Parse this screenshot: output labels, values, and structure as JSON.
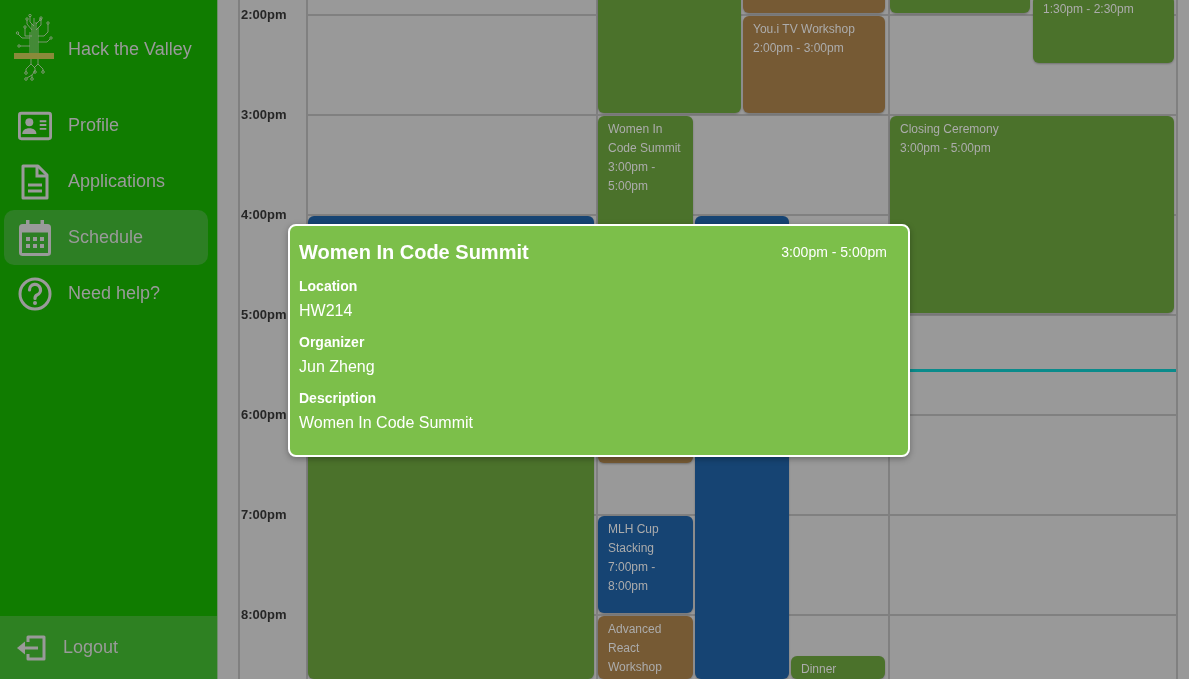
{
  "sidebar": {
    "brand": "Hack the Valley",
    "items": [
      {
        "label": "Profile",
        "selected": false
      },
      {
        "label": "Applications",
        "selected": false
      },
      {
        "label": "Schedule",
        "selected": true
      },
      {
        "label": "Need help?",
        "selected": false
      }
    ],
    "logout": "Logout"
  },
  "calendar": {
    "time_labels": [
      "2:00pm",
      "3:00pm",
      "4:00pm",
      "5:00pm",
      "6:00pm",
      "7:00pm",
      "8:00pm"
    ],
    "events": [
      {
        "color": "#4b722b"
      },
      {
        "color": "#765a34"
      },
      {
        "color": "#4b722b"
      },
      {
        "time": "1:30pm - 2:30pm",
        "color": "#4b722b"
      },
      {
        "title": "You.i TV Workshop",
        "time": "2:00pm - 3:00pm",
        "color": "#765a34"
      },
      {
        "title": "Women In Code Summit",
        "time": "3:00pm - 5:00pm",
        "color": "#4b722b"
      },
      {
        "title": "Closing Ceremony",
        "time": "3:00pm - 5:00pm",
        "color": "#4b722b"
      },
      {
        "color": "#164473"
      },
      {
        "color": "#164473"
      },
      {
        "color": "#765a34"
      },
      {
        "color": "#4b722b"
      },
      {
        "title": "MLH Cup Stacking",
        "time": "7:00pm - 8:00pm",
        "color": "#164473"
      },
      {
        "title": "Advanced React Workshop",
        "color": "#765a34"
      },
      {
        "title": "Dinner",
        "color": "#4b722b"
      }
    ]
  },
  "popup": {
    "title": "Women In Code Summit",
    "time": "3:00pm - 5:00pm",
    "fields": [
      {
        "label": "Location",
        "value": "HW214"
      },
      {
        "label": "Organizer",
        "value": "Jun Zheng"
      },
      {
        "label": "Description",
        "value": "Women In Code Summit"
      }
    ]
  }
}
